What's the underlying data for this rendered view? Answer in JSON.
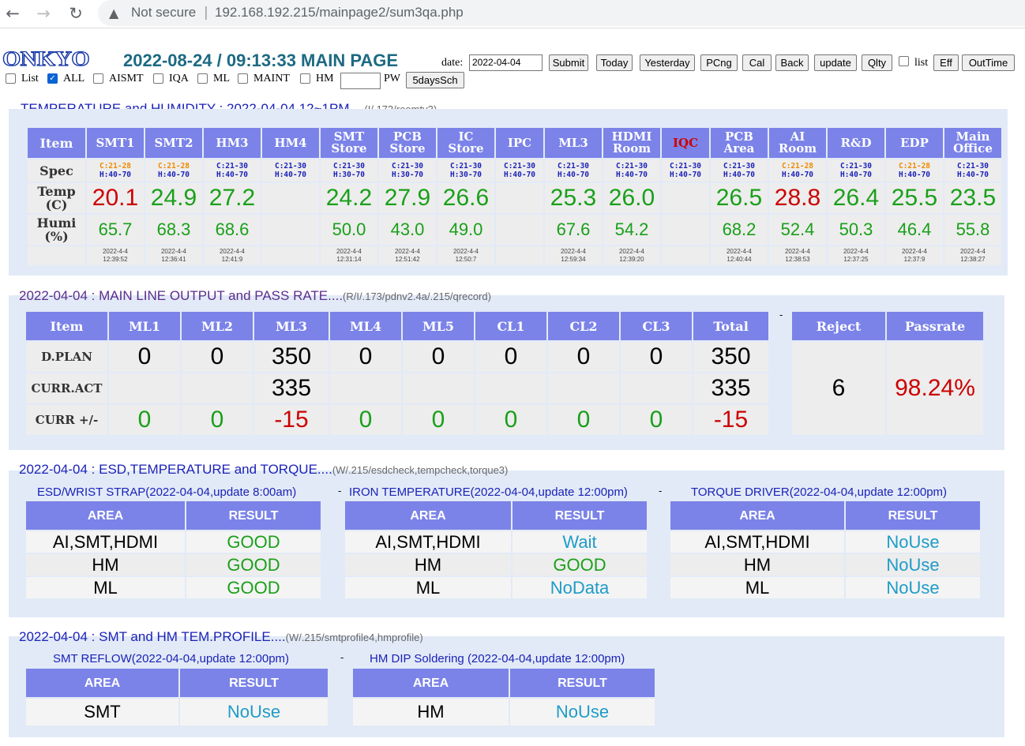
{
  "browser": {
    "security": "Not secure",
    "url": "192.168.192.215/mainpage2/sum3qa.php"
  },
  "header": {
    "logo": "ONKYO",
    "title": "2022-08-24 / 09:13:33 MAIN PAGE",
    "date_label": "date:",
    "date_value": "2022-04-04",
    "buttons": [
      "Submit",
      "Today",
      "Yesterday",
      "PCng",
      "Cal",
      "Back",
      "update",
      "Qlty"
    ],
    "list_label": "list",
    "buttons2": [
      "Eff",
      "OutTime"
    ],
    "filters": [
      {
        "label": "List",
        "checked": false
      },
      {
        "label": "ALL",
        "checked": true
      },
      {
        "label": "AISMT",
        "checked": false
      },
      {
        "label": "IQA",
        "checked": false
      },
      {
        "label": "ML",
        "checked": false
      },
      {
        "label": "MAINT",
        "checked": false
      },
      {
        "label": "HM",
        "checked": false
      }
    ],
    "pw_label": "PW",
    "sch_button": "5daysSch"
  },
  "temp": {
    "heading": "TEMPERATURE and HUMIDITY : 2022-04-04 12~1PM....",
    "source": "(I/.173/roomtv3)",
    "row_labels": {
      "item": "Item",
      "spec": "Spec",
      "temp1": "Temp",
      "temp2": "(C)",
      "humi1": "Humi",
      "humi2": "(%)"
    },
    "cols": [
      {
        "n1": "SMT1",
        "n2": "",
        "c": "C:21-28",
        "h": "H:40-70",
        "spec_color": "#f08a00",
        "t": "20.1",
        "t_color": "#cc0000",
        "hu": "65.7",
        "d": "2022-4-4",
        "tm": "12:39:52"
      },
      {
        "n1": "SMT2",
        "n2": "",
        "c": "C:21-28",
        "h": "H:40-70",
        "spec_color": "#f08a00",
        "t": "24.9",
        "t_color": "#1aa01a",
        "hu": "68.3",
        "d": "2022-4-4",
        "tm": "12:36:41"
      },
      {
        "n1": "HM3",
        "n2": "",
        "c": "C:21-30",
        "h": "H:40-70",
        "spec_color": "#1b22b8",
        "t": "27.2",
        "t_color": "#1aa01a",
        "hu": "68.6",
        "d": "2022-4-4",
        "tm": "12:41:9"
      },
      {
        "n1": "HM4",
        "n2": "",
        "c": "C:21-30",
        "h": "H:40-70",
        "spec_color": "#1b22b8",
        "t": "",
        "t_color": "#1aa01a",
        "hu": "",
        "d": "",
        "tm": ""
      },
      {
        "n1": "SMT",
        "n2": "Store",
        "c": "C:21-30",
        "h": "H:30-70",
        "spec_color": "#1b22b8",
        "t": "24.2",
        "t_color": "#1aa01a",
        "hu": "50.0",
        "d": "2022-4-4",
        "tm": "12:31:14"
      },
      {
        "n1": "PCB",
        "n2": "Store",
        "c": "C:21-30",
        "h": "H:30-70",
        "spec_color": "#1b22b8",
        "t": "27.9",
        "t_color": "#1aa01a",
        "hu": "43.0",
        "d": "2022-4-4",
        "tm": "12:51:42"
      },
      {
        "n1": "IC",
        "n2": "Store",
        "c": "C:21-30",
        "h": "H:30-70",
        "spec_color": "#1b22b8",
        "t": "26.6",
        "t_color": "#1aa01a",
        "hu": "49.0",
        "d": "2022-4-4",
        "tm": "12:50:7"
      },
      {
        "n1": "IPC",
        "n2": "",
        "c": "C:21-30",
        "h": "H:40-70",
        "spec_color": "#1b22b8",
        "t": "",
        "t_color": "#1aa01a",
        "hu": "",
        "d": "",
        "tm": ""
      },
      {
        "n1": "ML3",
        "n2": "",
        "c": "C:21-30",
        "h": "H:40-70",
        "spec_color": "#1b22b8",
        "t": "25.3",
        "t_color": "#1aa01a",
        "hu": "67.6",
        "d": "2022-4-4",
        "tm": "12:59:34"
      },
      {
        "n1": "HDMI",
        "n2": "Room",
        "c": "C:21-30",
        "h": "H:40-70",
        "spec_color": "#1b22b8",
        "t": "26.0",
        "t_color": "#1aa01a",
        "hu": "54.2",
        "d": "2022-4-4",
        "tm": "12:39:20"
      },
      {
        "n1": "IQC",
        "n2": "",
        "c": "C:21-30",
        "h": "H:40-70",
        "spec_color": "#1b22b8",
        "t": "",
        "t_color": "#1aa01a",
        "hu": "",
        "d": "",
        "tm": "",
        "hdr_color": "#cc0000"
      },
      {
        "n1": "PCB",
        "n2": "Area",
        "c": "C:21-30",
        "h": "H:40-70",
        "spec_color": "#1b22b8",
        "t": "26.5",
        "t_color": "#1aa01a",
        "hu": "68.2",
        "d": "2022-4-4",
        "tm": "12:40:44"
      },
      {
        "n1": "AI",
        "n2": "Room",
        "c": "C:21-28",
        "h": "H:40-70",
        "spec_color": "#f08a00",
        "t": "28.8",
        "t_color": "#cc0000",
        "hu": "52.4",
        "d": "2022-4-4",
        "tm": "12:38:53"
      },
      {
        "n1": "R&D",
        "n2": "",
        "c": "C:21-30",
        "h": "H:40-70",
        "spec_color": "#1b22b8",
        "t": "26.4",
        "t_color": "#1aa01a",
        "hu": "50.3",
        "d": "2022-4-4",
        "tm": "12:37:25"
      },
      {
        "n1": "EDP",
        "n2": "",
        "c": "C:21-28",
        "h": "H:40-70",
        "spec_color": "#f08a00",
        "t": "25.5",
        "t_color": "#1aa01a",
        "hu": "46.4",
        "d": "2022-4-4",
        "tm": "12:37:9"
      },
      {
        "n1": "Main",
        "n2": "Office",
        "c": "C:21-30",
        "h": "H:40-70",
        "spec_color": "#1b22b8",
        "t": "23.5",
        "t_color": "#1aa01a",
        "hu": "55.8",
        "d": "2022-4-4",
        "tm": "12:38:27"
      }
    ]
  },
  "output": {
    "heading": "2022-04-04 : MAIN LINE OUTPUT and PASS RATE....",
    "source": "(R/I/.173/pdnv2.4a/.215/qrecord)",
    "headers": [
      "Item",
      "ML1",
      "ML2",
      "ML3",
      "ML4",
      "ML5",
      "CL1",
      "CL2",
      "CL3",
      "Total"
    ],
    "rows": [
      {
        "label": "D.PLAN",
        "vals": [
          "0",
          "0",
          "350",
          "0",
          "0",
          "0",
          "0",
          "0",
          "350"
        ],
        "colors": [
          "#000",
          "#000",
          "#000",
          "#000",
          "#000",
          "#000",
          "#000",
          "#000",
          "#000"
        ]
      },
      {
        "label": "CURR.ACT",
        "vals": [
          "",
          "",
          "335",
          "",
          "",
          "",
          "",
          "",
          "335"
        ],
        "colors": [
          "#000",
          "#000",
          "#000",
          "#000",
          "#000",
          "#000",
          "#000",
          "#000",
          "#000"
        ]
      },
      {
        "label": "CURR +/-",
        "vals": [
          "0",
          "0",
          "-15",
          "0",
          "0",
          "0",
          "0",
          "0",
          "-15"
        ],
        "colors": [
          "#1aa01a",
          "#1aa01a",
          "#cc0000",
          "#1aa01a",
          "#1aa01a",
          "#1aa01a",
          "#1aa01a",
          "#1aa01a",
          "#cc0000"
        ]
      }
    ],
    "reject_label": "Reject",
    "passrate_label": "Passrate",
    "reject": "6",
    "passrate": "98.24%",
    "dash": "-"
  },
  "esd": {
    "heading": "2022-04-04 : ESD,TEMPERATURE and TORQUE....",
    "source": "(W/.215/esdcheck,tempcheck,torque3)",
    "col_area": "AREA",
    "col_result": "RESULT",
    "tables": [
      {
        "title": "ESD/WRIST STRAP(2022-04-04,update 8:00am)",
        "rows": [
          {
            "a": "AI,SMT,HDMI",
            "r": "GOOD",
            "c": "#1aa01a"
          },
          {
            "a": "HM",
            "r": "GOOD",
            "c": "#1aa01a"
          },
          {
            "a": "ML",
            "r": "GOOD",
            "c": "#1aa01a"
          }
        ]
      },
      {
        "title": "IRON TEMPERATURE(2022-04-04,update 12:00pm)",
        "rows": [
          {
            "a": "AI,SMT,HDMI",
            "r": "Wait",
            "c": "#1e9bc8"
          },
          {
            "a": "HM",
            "r": "GOOD",
            "c": "#1aa01a"
          },
          {
            "a": "ML",
            "r": "NoData",
            "c": "#1e9bc8"
          }
        ]
      },
      {
        "title": "TORQUE DRIVER(2022-04-04,update 12:00pm)",
        "rows": [
          {
            "a": "AI,SMT,HDMI",
            "r": "NoUse",
            "c": "#1e9bc8"
          },
          {
            "a": "HM",
            "r": "NoUse",
            "c": "#1e9bc8"
          },
          {
            "a": "ML",
            "r": "NoUse",
            "c": "#1e9bc8"
          }
        ]
      }
    ]
  },
  "profile": {
    "heading": "2022-04-04 : SMT and HM TEM.PROFILE....",
    "source": "(W/.215/smtprofile4,hmprofile)",
    "col_area": "AREA",
    "col_result": "RESULT",
    "tables": [
      {
        "title": "SMT REFLOW(2022-04-04,update 12:00pm)",
        "rows": [
          {
            "a": "SMT",
            "r": "NoUse",
            "c": "#1e9bc8"
          }
        ]
      },
      {
        "title": "HM DIP Soldering (2022-04-04,update 12:00pm)",
        "rows": [
          {
            "a": "HM",
            "r": "NoUse",
            "c": "#1e9bc8"
          }
        ]
      }
    ]
  }
}
